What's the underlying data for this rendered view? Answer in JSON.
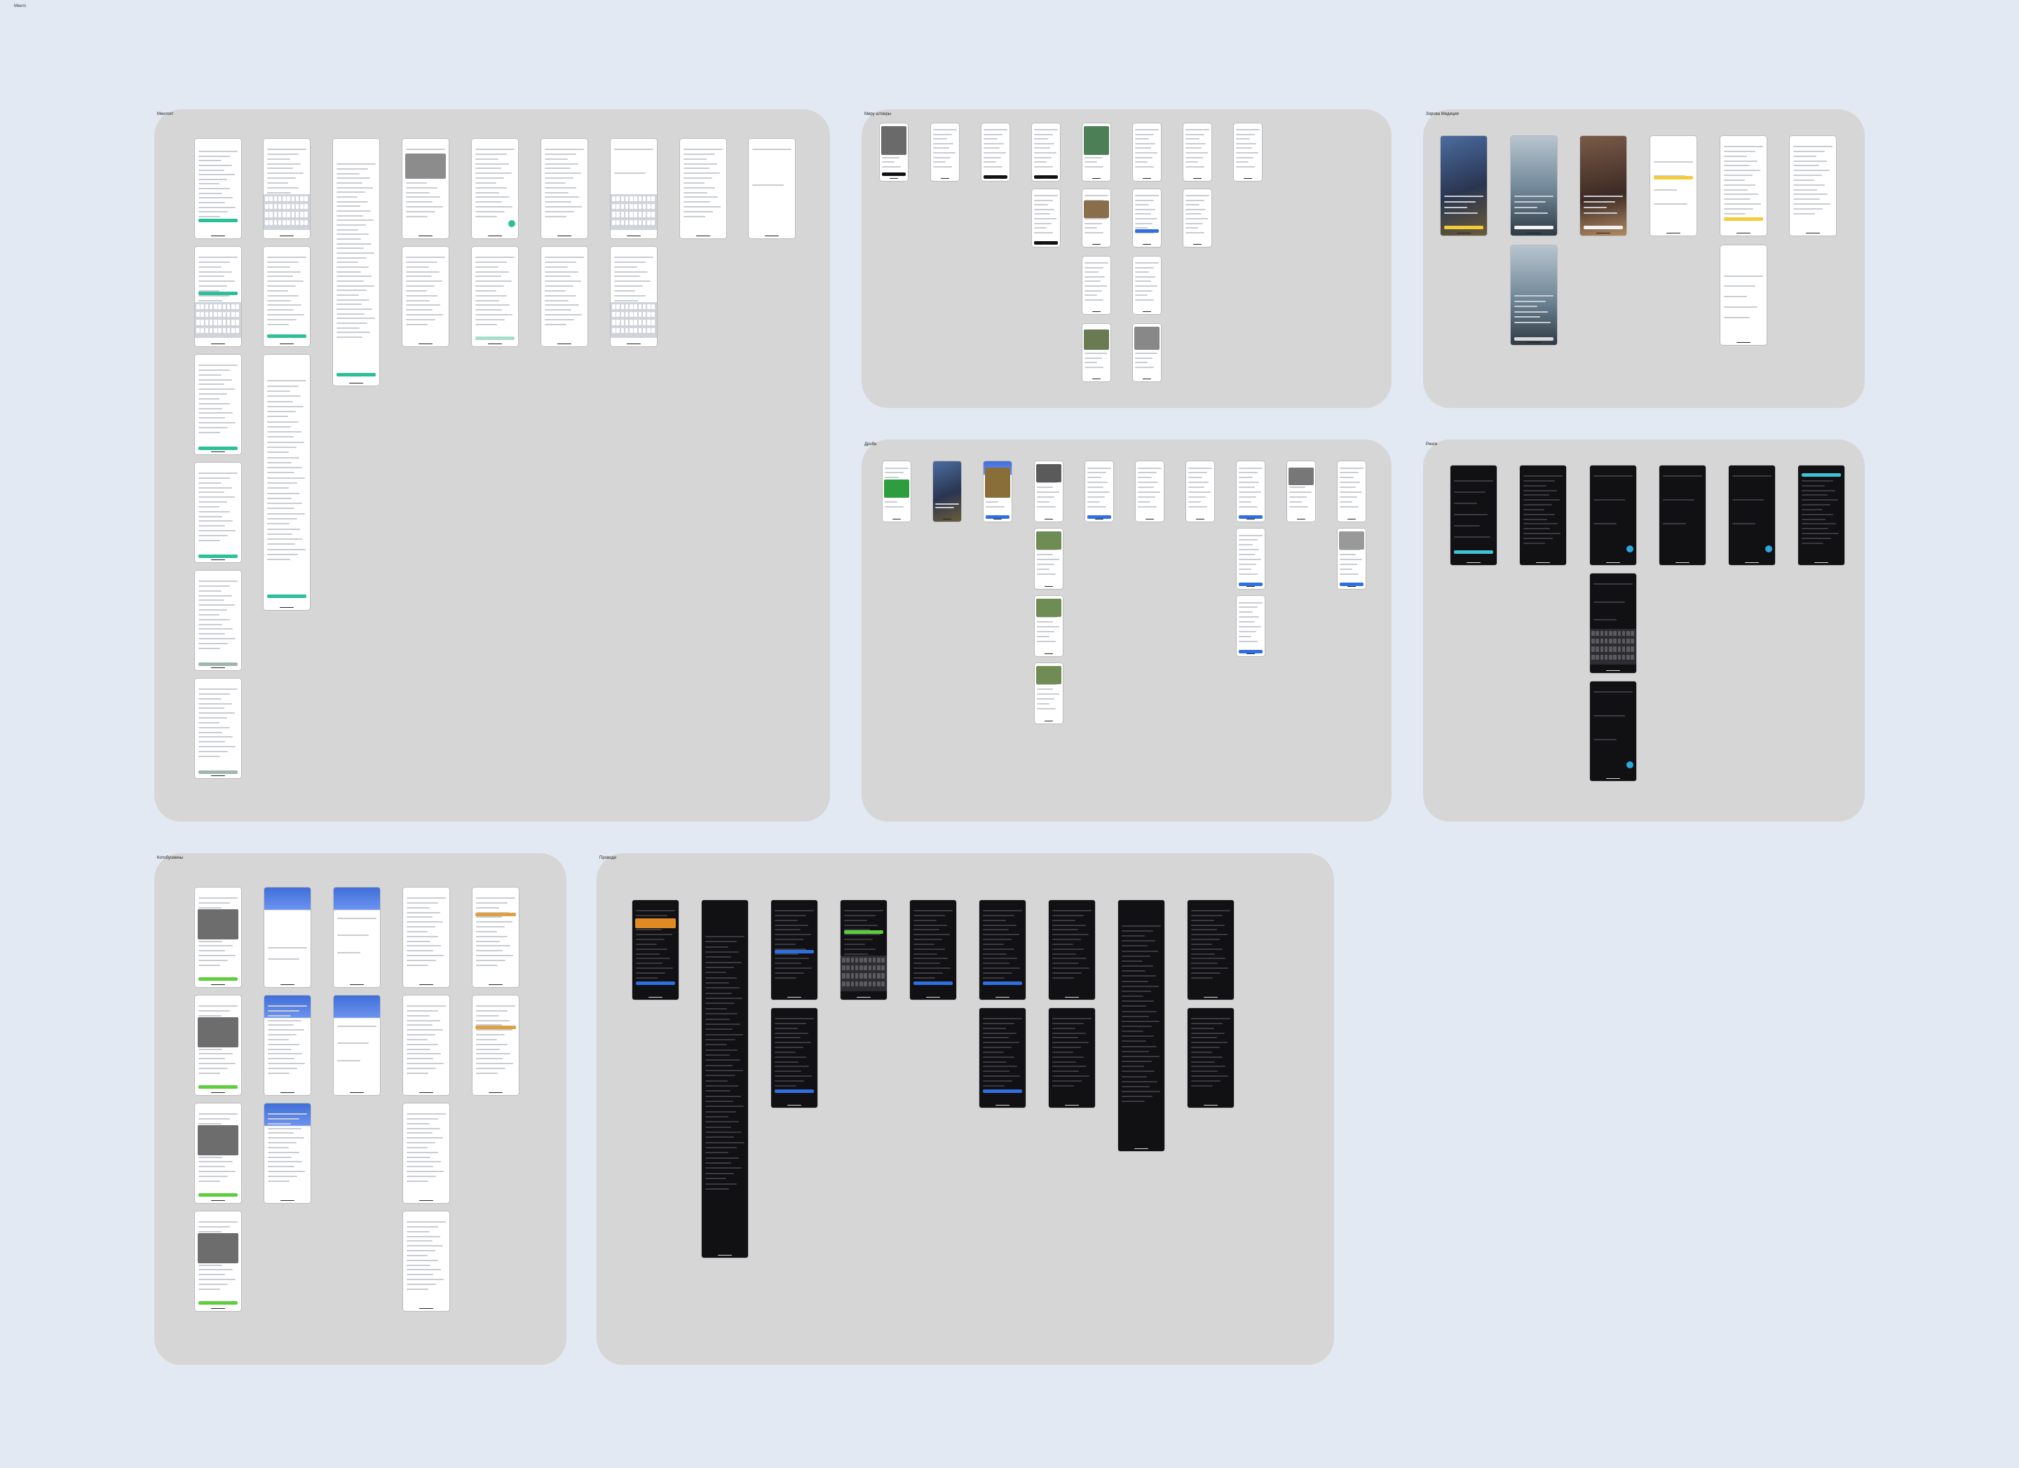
{
  "page": {
    "label": "Ментс"
  },
  "sections": [
    {
      "id": "s1",
      "title": "Ментсит"
    },
    {
      "id": "s2",
      "title": "Миру штоиры"
    },
    {
      "id": "s3",
      "title": "Зорова Медиция"
    },
    {
      "id": "s4",
      "title": "Дроби"
    },
    {
      "id": "s5",
      "title": "Ринги"
    },
    {
      "id": "s6",
      "title": "Котобусмины"
    },
    {
      "id": "s7",
      "title": "Проводи"
    }
  ],
  "colors": {
    "canvas": "#e2e9f2",
    "section": "#d6d6d6",
    "accent_green": "#2bbf9a",
    "accent_blue": "#2f6fe0",
    "accent_yellow": "#f4cc3a",
    "accent_lime": "#5fce3c",
    "accent_cyan": "#2aa7e0",
    "accent_red": "#e03030"
  }
}
